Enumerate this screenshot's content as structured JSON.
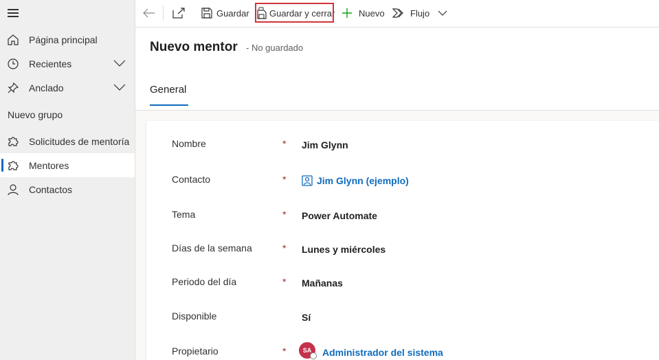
{
  "sidebar": {
    "items": [
      {
        "label": "Página principal",
        "icon": "home-icon"
      },
      {
        "label": "Recientes",
        "icon": "clock-icon"
      },
      {
        "label": "Anclado",
        "icon": "pin-icon"
      }
    ],
    "group_title": "Nuevo grupo",
    "group_items": [
      {
        "label": "Solicitudes de mentoría",
        "icon": "puzzle-icon"
      },
      {
        "label": "Mentores",
        "icon": "puzzle-icon",
        "active": true
      },
      {
        "label": "Contactos",
        "icon": "person-icon"
      }
    ]
  },
  "toolbar": {
    "save_label": "Guardar",
    "save_close_label": "Guardar y cerrar",
    "new_label": "Nuevo",
    "flow_label": "Flujo"
  },
  "header": {
    "title": "Nuevo mentor",
    "subtitle": "- No guardado",
    "tab": "General"
  },
  "form": {
    "fields": [
      {
        "label": "Nombre",
        "required": "*",
        "value": "Jim Glynn"
      },
      {
        "label": "Contacto",
        "required": "*",
        "value": "Jim Glynn (ejemplo)"
      },
      {
        "label": "Tema",
        "required": "*",
        "value": "Power Automate"
      },
      {
        "label": "Días de la semana",
        "required": "*",
        "value": "Lunes y miércoles"
      },
      {
        "label": "Periodo del día",
        "required": "*",
        "value": "Mañanas"
      },
      {
        "label": "Disponible",
        "required": "",
        "value": "Sí"
      },
      {
        "label": "Propietario",
        "required": "*",
        "value": "Administrador del sistema",
        "avatar": "SA"
      }
    ]
  },
  "colors": {
    "accent": "#0f6cbd",
    "required": "#a4262c",
    "highlight": "#d13438",
    "avatar": "#c4314b"
  }
}
